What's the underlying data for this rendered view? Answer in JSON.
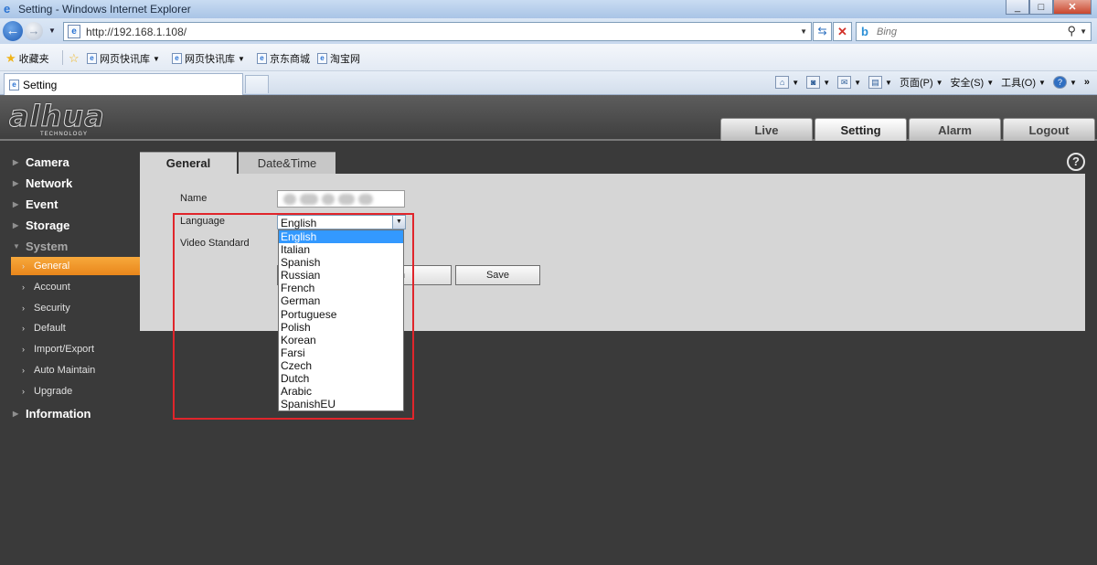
{
  "window": {
    "title": "Setting - Windows Internet Explorer",
    "minimize": "_",
    "maximize": "□",
    "close": "✕"
  },
  "address_bar": {
    "url": "http://192.168.1.108/",
    "search_placeholder": "Bing"
  },
  "favorites_bar": {
    "favorites_label": "收藏夹",
    "items": [
      "网页快讯库",
      "网页快讯库",
      "京东商城",
      "淘宝网"
    ]
  },
  "browser_tab": {
    "label": "Setting"
  },
  "command_bar": {
    "page": "页面(P)",
    "safety": "安全(S)",
    "tools": "工具(O)"
  },
  "header": {
    "brand": "alhua",
    "brand_sub": "TECHNOLOGY",
    "tabs": [
      {
        "label": "Live"
      },
      {
        "label": "Setting"
      },
      {
        "label": "Alarm"
      },
      {
        "label": "Logout"
      }
    ],
    "active_tab": "Setting"
  },
  "sidebar": {
    "items": [
      {
        "label": "Camera"
      },
      {
        "label": "Network"
      },
      {
        "label": "Event"
      },
      {
        "label": "Storage"
      },
      {
        "label": "System"
      },
      {
        "label": "Information"
      }
    ],
    "system_subitems": [
      {
        "label": "General"
      },
      {
        "label": "Account"
      },
      {
        "label": "Security"
      },
      {
        "label": "Default"
      },
      {
        "label": "Import/Export"
      },
      {
        "label": "Auto Maintain"
      },
      {
        "label": "Upgrade"
      }
    ],
    "active_subitem": "General"
  },
  "content": {
    "tabs": [
      {
        "label": "General"
      },
      {
        "label": "Date&Time"
      }
    ],
    "active_tab": "General",
    "help": "?",
    "form": {
      "name_label": "Name",
      "language_label": "Language",
      "language_value": "English",
      "video_standard_label": "Video Standard",
      "refresh_button": "Refresh",
      "refresh_visible": "fresh",
      "save_button": "Save"
    },
    "language_options": [
      "English",
      "Italian",
      "Spanish",
      "Russian",
      "French",
      "German",
      "Portuguese",
      "Polish",
      "Korean",
      "Farsi",
      "Czech",
      "Dutch",
      "Arabic",
      "SpanishEU"
    ],
    "selected_option": "English"
  },
  "colors": {
    "accent_orange": "#f29a2e",
    "highlight_red": "#e0252b",
    "selection_blue": "#3399ff",
    "background_dark": "#3a3a3a",
    "panel_gray": "#d6d6d6"
  }
}
